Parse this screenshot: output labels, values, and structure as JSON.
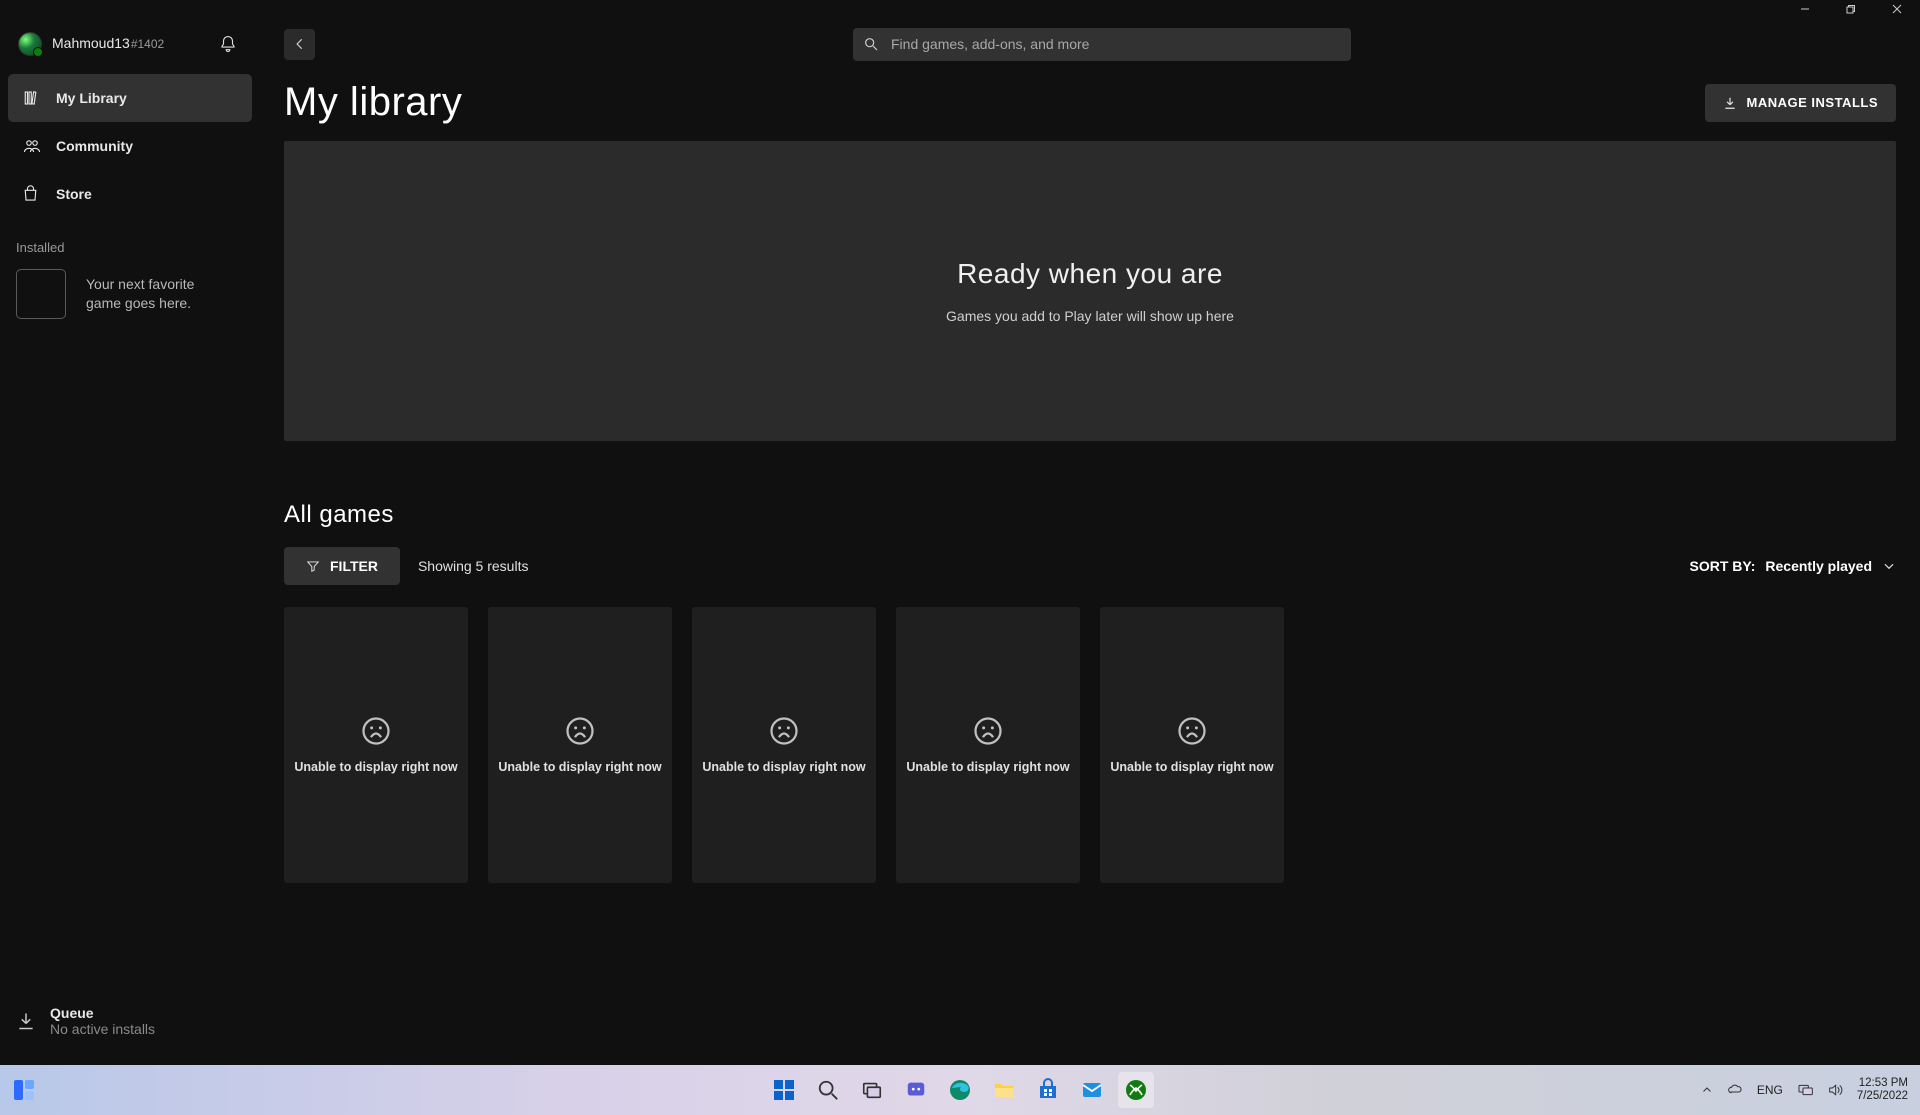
{
  "user": {
    "name": "Mahmoud13",
    "tag": "#1402"
  },
  "search": {
    "placeholder": "Find games, add-ons, and more"
  },
  "nav": {
    "my_library": "My Library",
    "community": "Community",
    "store": "Store"
  },
  "installed": {
    "label": "Installed",
    "placeholder_line1": "Your next favorite",
    "placeholder_line2": "game goes here."
  },
  "queue": {
    "title": "Queue",
    "sub": "No active installs"
  },
  "page": {
    "title": "My library",
    "manage_btn": "MANAGE INSTALLS",
    "hero_title": "Ready when you are",
    "hero_sub": "Games you add to Play later will show up here",
    "all_games": "All games",
    "filter_btn": "FILTER",
    "results": "Showing 5 results",
    "sort_label": "SORT BY:",
    "sort_value": "Recently played",
    "card_text": "Unable to display right now"
  },
  "cards": [
    {
      "text_key": "page.card_text"
    },
    {
      "text_key": "page.card_text"
    },
    {
      "text_key": "page.card_text"
    },
    {
      "text_key": "page.card_text"
    },
    {
      "text_key": "page.card_text"
    }
  ],
  "taskbar": {
    "lang": "ENG",
    "time": "12:53 PM",
    "date": "7/25/2022"
  }
}
